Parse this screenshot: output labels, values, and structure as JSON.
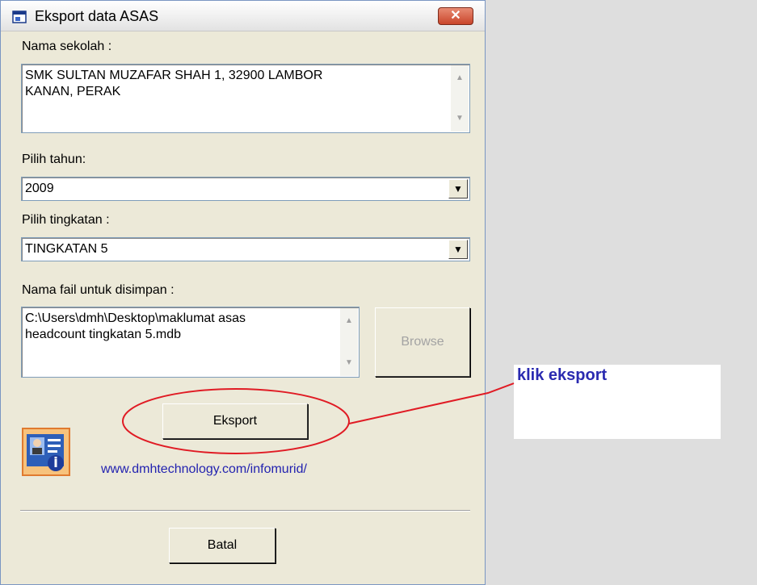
{
  "window": {
    "title": "Eksport data ASAS",
    "close_label": "✕"
  },
  "school": {
    "label": "Nama sekolah :",
    "value_line1": "SMK SULTAN MUZAFAR SHAH 1, 32900 LAMBOR",
    "value_line2": "KANAN, PERAK"
  },
  "year": {
    "label": "Pilih tahun:",
    "selected": "2009"
  },
  "grade": {
    "label": "Pilih tingkatan :",
    "selected": "TINGKATAN 5"
  },
  "file": {
    "label": "Nama fail untuk disimpan :",
    "value_line1": "C:\\Users\\dmh\\Desktop\\maklumat asas",
    "value_line2": "headcount tingkatan 5.mdb",
    "browse_label": "Browse"
  },
  "export_button": {
    "label": "Eksport"
  },
  "website": {
    "url": "www.dmhtechnology.com/infomurid/"
  },
  "cancel_button": {
    "label": "Batal"
  },
  "annotation": {
    "text": "klik eksport",
    "color": "#e01b24"
  },
  "icons": {
    "app": "window-app-icon",
    "info": "info-card-icon",
    "dropdown": "chevron-down-icon"
  }
}
